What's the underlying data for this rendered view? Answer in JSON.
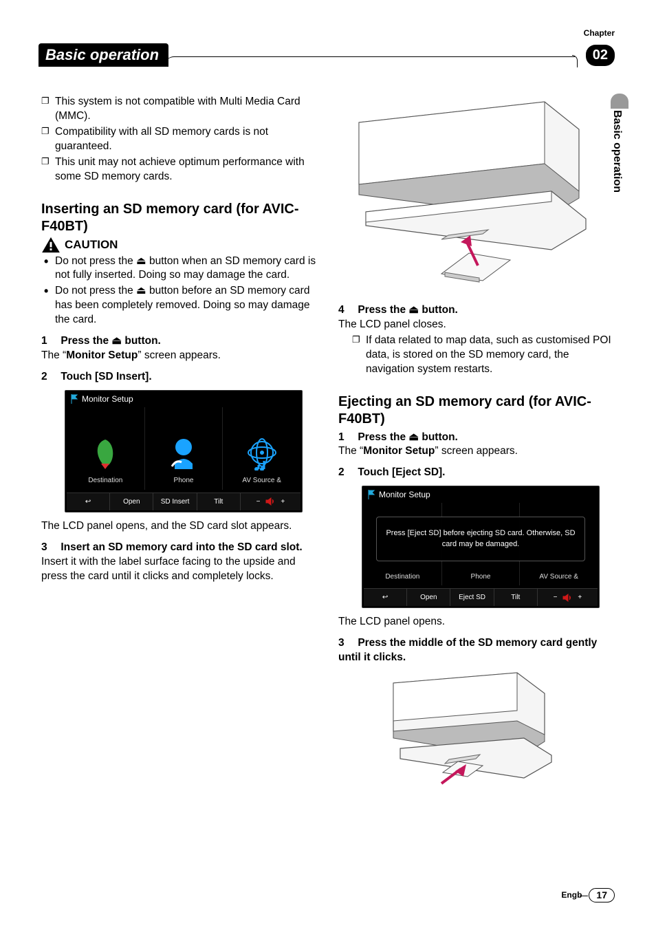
{
  "chapter_label": "Chapter",
  "chapter_number": "02",
  "section_title": "Basic operation",
  "side_tab": "Basic operation",
  "left_column": {
    "notes": [
      "This system is not compatible with Multi Media Card (MMC).",
      "Compatibility with all SD memory cards is not guaranteed.",
      "This unit may not achieve optimum performance with some SD memory cards."
    ],
    "heading_insert": "Inserting an SD memory card (for AVIC-F40BT)",
    "caution": "CAUTION",
    "caution_items": [
      "Do not press the ⏏ button when an SD memory card is not fully inserted. Doing so may damage the card.",
      "Do not press the ⏏ button before an SD memory card has been completely removed. Doing so may damage the card."
    ],
    "step1_num": "1",
    "step1_head": "Press the ⏏ button.",
    "step1_body_pre": "The “",
    "step1_body_strong": "Monitor Setup",
    "step1_body_post": "” screen appears.",
    "step2_num": "2",
    "step2_head": "Touch [SD Insert].",
    "monitor_setup": {
      "title": "Monitor Setup",
      "tabs": [
        "Destination",
        "Phone",
        "AV Source &"
      ],
      "bottom": [
        "↩",
        "Open",
        "SD Insert",
        "Tilt"
      ],
      "vol_minus": "−",
      "vol_plus": "+"
    },
    "after_ms1": "The LCD panel opens, and the SD card slot appears.",
    "step3_num": "3",
    "step3_head": "Insert an SD memory card into the SD card slot.",
    "step3_body": "Insert it with the label surface facing to the upside and press the card until it clicks and completely locks."
  },
  "right_column": {
    "step4_num": "4",
    "step4_head": "Press the ⏏ button.",
    "step4_body": "The LCD panel closes.",
    "step4_note": "If data related to map data, such as customised POI data, is stored on the SD memory card, the navigation system restarts.",
    "heading_eject": "Ejecting an SD memory card (for AVIC-F40BT)",
    "step1_num": "1",
    "step1_head": "Press the ⏏ button.",
    "step1_body_pre": "The “",
    "step1_body_strong": "Monitor Setup",
    "step1_body_post": "” screen appears.",
    "step2_num": "2",
    "step2_head": "Touch [Eject SD].",
    "monitor_setup": {
      "title": "Monitor Setup",
      "message": "Press [Eject SD] before ejecting SD card. Otherwise, SD card may be damaged.",
      "tabs": [
        "Destination",
        "Phone",
        "AV Source &"
      ],
      "bottom": [
        "↩",
        "Open",
        "Eject SD",
        "Tilt"
      ],
      "vol_minus": "−",
      "vol_plus": "+"
    },
    "after_ms2": "The LCD panel opens.",
    "step3_num": "3",
    "step3_head": "Press the middle of the SD memory card gently until it clicks."
  },
  "footer": {
    "lang": "Engb",
    "page": "17"
  }
}
